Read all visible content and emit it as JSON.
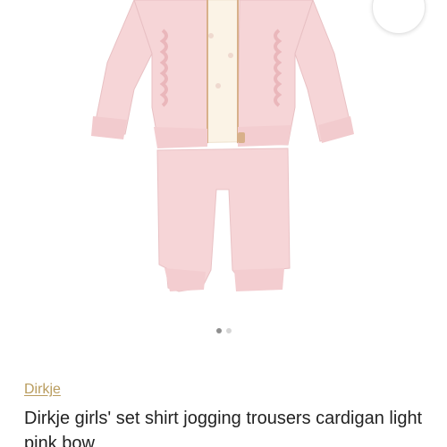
{
  "product": {
    "brand": "Dirkje",
    "title": "Dirkje girls' set shirt jogging trousers cardigan light pink bow"
  },
  "wishlist": {
    "icon": "heart-outline-icon"
  },
  "carousel": {
    "slide_count": 2,
    "active_index": 0
  },
  "colors": {
    "brand_link": "#b99c5e",
    "garment_pink": "#f6d5d7",
    "shirt_cream": "#fbf3e6"
  }
}
